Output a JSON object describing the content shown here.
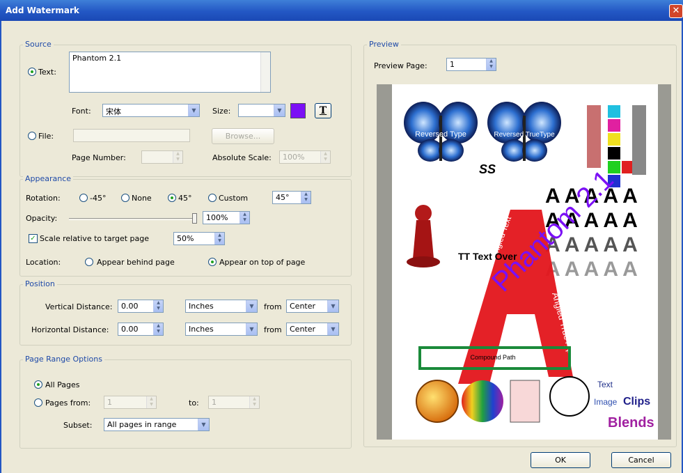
{
  "window": {
    "title": "Add Watermark",
    "close_glyph": "✕"
  },
  "source": {
    "legend": "Source",
    "text_option": "Text:",
    "text_value": "Phantom 2.1",
    "font_label": "Font:",
    "font_value": "宋体",
    "size_label": "Size:",
    "size_value": "",
    "color": "#7b10f5",
    "text_style_glyph": "T",
    "file_option": "File:",
    "file_value": "",
    "browse_label": "Browse...",
    "page_number_label": "Page Number:",
    "page_number_value": "",
    "absolute_scale_label": "Absolute Scale:",
    "absolute_scale_value": "100%"
  },
  "appearance": {
    "legend": "Appearance",
    "rotation_label": "Rotation:",
    "rot_m45": "-45°",
    "rot_none": "None",
    "rot_45": "45°",
    "rot_custom": "Custom",
    "rotation_value": "45°",
    "opacity_label": "Opacity:",
    "opacity_value": "100%",
    "opacity_level": 1.0,
    "scale_label": "Scale relative to target page",
    "scale_value": "50%",
    "location_label": "Location:",
    "loc_behind": "Appear behind page",
    "loc_top": "Appear on top of page"
  },
  "position": {
    "legend": "Position",
    "vertical_label": "Vertical Distance:",
    "vertical_value": "0.00",
    "vertical_unit": "Inches",
    "from1": "from",
    "vertical_from": "Center",
    "horizontal_label": "Horizontal Distance:",
    "horizontal_value": "0.00",
    "horizontal_unit": "Inches",
    "from2": "from",
    "horizontal_from": "Center"
  },
  "page_range": {
    "legend": "Page Range Options",
    "all_pages": "All Pages",
    "pages_from": "Pages from:",
    "from_value": "1",
    "to_label": "to:",
    "to_value": "1",
    "subset_label": "Subset:",
    "subset_value": "All pages in range"
  },
  "preview": {
    "legend": "Preview",
    "page_label": "Preview Page:",
    "page_value": "1",
    "watermark_text": "Phantom 2.1",
    "butterfly1_text": "Reversed Type",
    "butterfly2_text": "Reversed TrueType",
    "ss_label": "SS",
    "over_text": "TT Text Over",
    "compound_path": "Compound Path",
    "fonts_word": "Text",
    "image_word": "Image",
    "clips_word": "Clips",
    "blends_word": "Blends",
    "angled_text": "Angled TrueType",
    "angled_text2": "Angled Text"
  },
  "buttons": {
    "ok": "OK",
    "cancel": "Cancel"
  }
}
